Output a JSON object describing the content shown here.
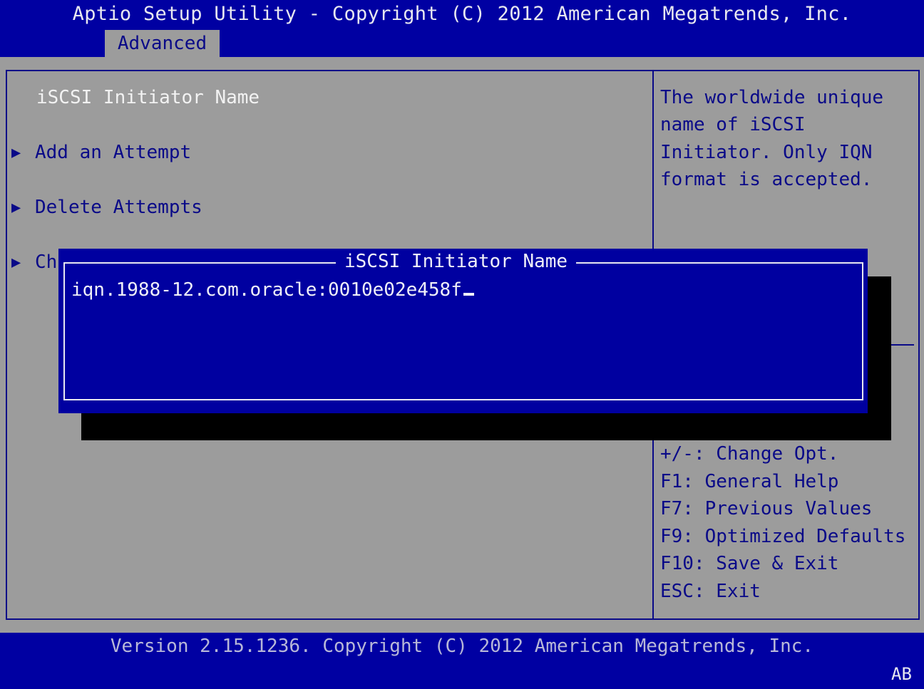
{
  "header": {
    "title": "Aptio Setup Utility - Copyright (C) 2012 American Megatrends, Inc.",
    "active_tab": "Advanced"
  },
  "menu": {
    "items": [
      {
        "label": "iSCSI Initiator Name",
        "has_submenu": false,
        "highlighted": true
      },
      {
        "label": "Add an Attempt",
        "has_submenu": true
      },
      {
        "label": "Delete Attempts",
        "has_submenu": true
      },
      {
        "label": "Ch",
        "has_submenu": true
      }
    ],
    "arrow_glyph": "▶"
  },
  "help_panel": {
    "description_lines": [
      "The worldwide unique",
      "name of iSCSI",
      "Initiator. Only IQN",
      "format is accepted."
    ],
    "keys": [
      "+/-: Change Opt.",
      "F1: General Help",
      "F7: Previous Values",
      "F9: Optimized Defaults",
      "F10: Save & Exit",
      "ESC: Exit"
    ]
  },
  "dialog": {
    "title": "iSCSI Initiator Name",
    "value": "iqn.1988-12.com.oracle:0010e02e458f"
  },
  "footer": {
    "version_text": "Version 2.15.1236. Copyright (C) 2012 American Megatrends, Inc.",
    "indicator": "AB"
  },
  "colors": {
    "bios_blue": "#0000a2",
    "bios_gray": "#9c9c9c",
    "text_blue": "#0a0a88",
    "text_white": "#f2f2f2"
  }
}
